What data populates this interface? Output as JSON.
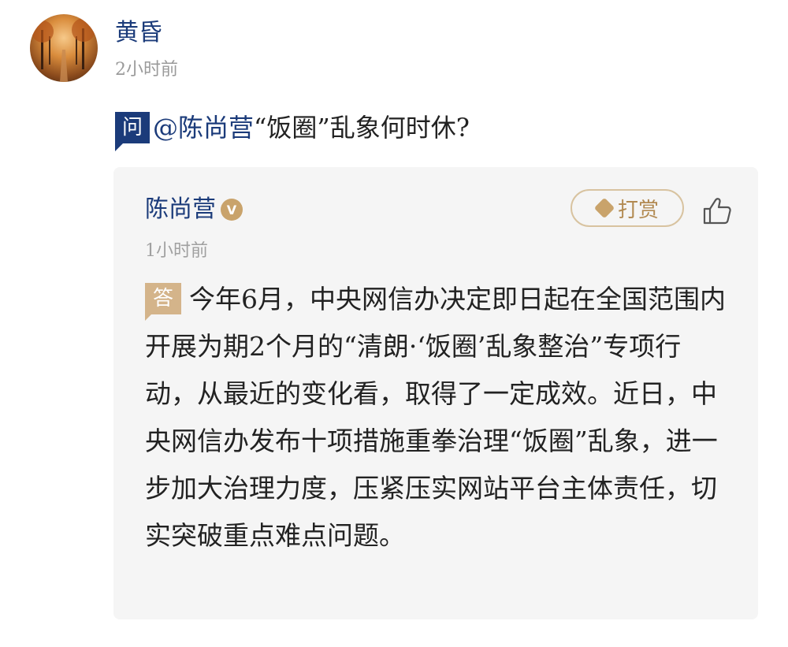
{
  "asker": {
    "name": "黄昏",
    "time": "2小时前",
    "avatar_icon": "autumn-road-avatar"
  },
  "question": {
    "badge": "问",
    "mention": "@陈尚营",
    "text": "“饭圈”乱象何时休?"
  },
  "answer": {
    "author": "陈尚营",
    "verified_badge": "V",
    "tip_label": "打赏",
    "time": "1小时前",
    "badge": "答",
    "text": "今年6月，中央网信办决定即日起在全国范围内开展为期2个月的“清朗·‘饭圈’乱象整治”专项行动，从最近的变化看，取得了一定成效。近日，中央网信办发布十项措施重拳治理“饭圈”乱象，进一步加大治理力度，压紧压实网站平台主体责任，切实突破重点难点问题。"
  },
  "colors": {
    "accent_blue": "#1b3b7a",
    "gold": "#c9a36b",
    "card_bg": "#f5f5f5"
  }
}
